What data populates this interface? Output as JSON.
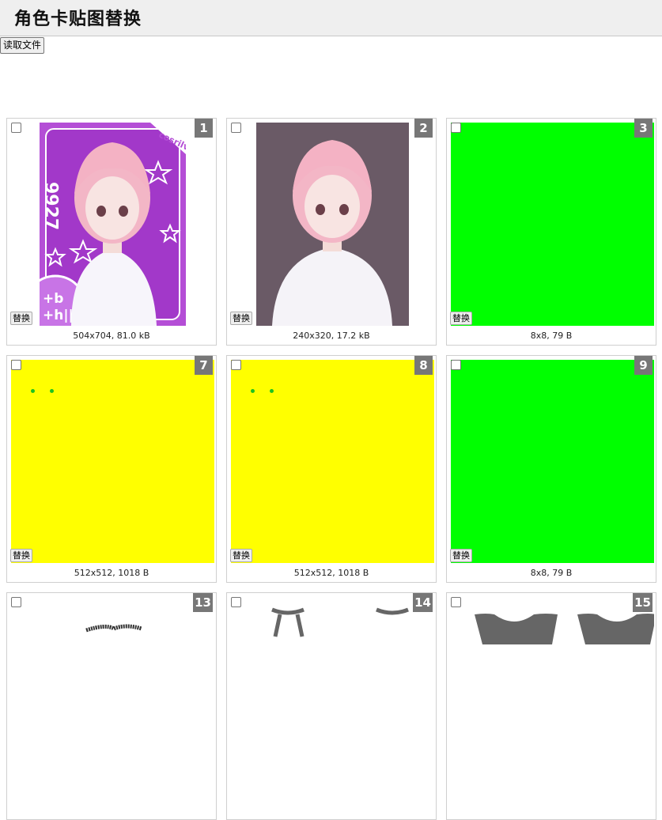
{
  "header": {
    "title": "角色卡贴图替换"
  },
  "toolbar": {
    "read_file_label": "读取文件"
  },
  "cards": [
    {
      "num": "1",
      "info": "504x704, 81.0 kB",
      "replace_label": "替换",
      "fill": "#b44ed6"
    },
    {
      "num": "2",
      "info": "240x320, 17.2 kB",
      "replace_label": "替换",
      "fill": "#6a5a66"
    },
    {
      "num": "3",
      "info": "8x8, 79 B",
      "replace_label": "替换",
      "fill": "#00ff00"
    },
    {
      "num": "7",
      "info": "512x512, 1018 B",
      "replace_label": "替换",
      "fill": "#ffff00"
    },
    {
      "num": "8",
      "info": "512x512, 1018 B",
      "replace_label": "替换",
      "fill": "#ffff00"
    },
    {
      "num": "9",
      "info": "8x8, 79 B",
      "replace_label": "替换",
      "fill": "#00ff00"
    },
    {
      "num": "13",
      "info": "",
      "replace_label": "",
      "fill": "#ffffff"
    },
    {
      "num": "14",
      "info": "",
      "replace_label": "",
      "fill": "#ffffff"
    },
    {
      "num": "15",
      "info": "",
      "replace_label": "",
      "fill": "#ffffff"
    }
  ],
  "card1_art": {
    "side_text": "9927",
    "corner_text": "cosrilver",
    "badge_text_1": "+b",
    "badge_text_2": "+h||"
  }
}
